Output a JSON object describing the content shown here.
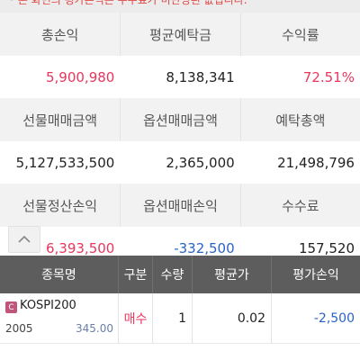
{
  "notice": {
    "text": "* 본 화면의 평가손익은 수수료가 미반영된 값입니다."
  },
  "summary": {
    "rows": [
      {
        "headers": [
          "총손익",
          "평균예탁금",
          "수익률"
        ],
        "values": [
          "5,900,980",
          "8,138,341",
          "72.51%"
        ]
      },
      {
        "headers": [
          "선물매매금액",
          "옵션매매금액",
          "예탁총액"
        ],
        "values": [
          "5,127,533,500",
          "2,365,000",
          "21,498,796"
        ]
      },
      {
        "headers": [
          "선물정산손익",
          "옵션매매손익",
          "수수료"
        ],
        "values": [
          "6,393,500",
          "-332,500",
          "157,520"
        ]
      }
    ],
    "collapse_icon": "chevron-up-icon"
  },
  "positions": {
    "columns": [
      "종목명",
      "구분",
      "수량",
      "평균가",
      "평가손익"
    ],
    "rows": [
      {
        "badge": "C",
        "name": "KOSPI200",
        "month": "2005",
        "strike": "345.00",
        "side": "매수",
        "qty": "1",
        "avg": "0.02",
        "pnl": "-2,500"
      }
    ]
  },
  "colors": {
    "profit": "#e8365d",
    "loss": "#2a63c8",
    "table_header": "#5d5d5d"
  }
}
